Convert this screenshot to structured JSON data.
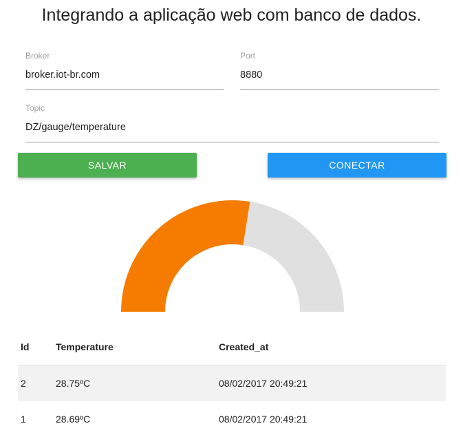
{
  "page": {
    "title": "Integrando a aplicação web com banco de dados."
  },
  "form": {
    "broker": {
      "label": "Broker",
      "value": "broker.iot-br.com"
    },
    "port": {
      "label": "Port",
      "value": "8880"
    },
    "topic": {
      "label": "Topic",
      "value": "DZ/gauge/temperature"
    }
  },
  "buttons": {
    "save_label": "SALVAR",
    "connect_label": "CONECTAR"
  },
  "gauge": {
    "level": 0.55,
    "fill_color": "#f57c00",
    "track_color": "#e0e0e0"
  },
  "table": {
    "headers": [
      "Id",
      "Temperature",
      "Created_at"
    ],
    "rows": [
      [
        "2",
        "28.75ºC",
        "08/02/2017 20:49:21"
      ],
      [
        "1",
        "28.69ºC",
        "08/02/2017 20:49:21"
      ]
    ]
  },
  "colors": {
    "save": "#4caf50",
    "connect": "#2196f3"
  }
}
